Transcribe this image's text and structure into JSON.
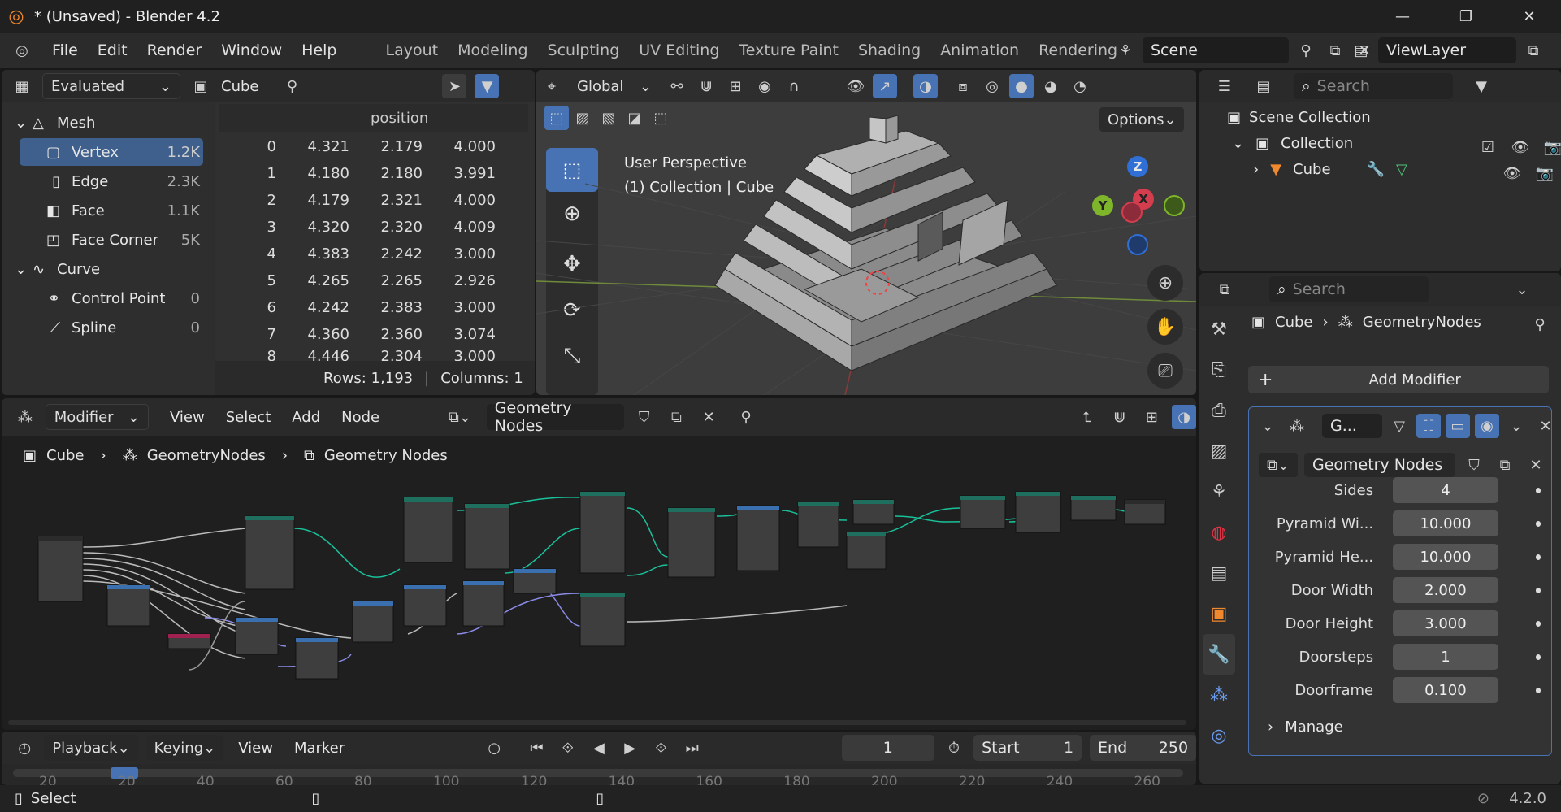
{
  "window": {
    "title": "* (Unsaved) - Blender 4.2"
  },
  "menu": [
    "File",
    "Edit",
    "Render",
    "Window",
    "Help"
  ],
  "workspaces": [
    "Layout",
    "Modeling",
    "Sculpting",
    "UV Editing",
    "Texture Paint",
    "Shading",
    "Animation",
    "Rendering"
  ],
  "scene": {
    "name": "Scene",
    "view_layer": "ViewLayer"
  },
  "spreadsheet": {
    "mode": "Evaluated",
    "object": "Cube",
    "column_header": "position",
    "tree": [
      {
        "label": "Mesh",
        "count": ""
      },
      {
        "label": "Vertex",
        "count": "1.2K"
      },
      {
        "label": "Edge",
        "count": "2.3K"
      },
      {
        "label": "Face",
        "count": "1.1K"
      },
      {
        "label": "Face Corner",
        "count": "5K"
      },
      {
        "label": "Curve",
        "count": ""
      },
      {
        "label": "Control Point",
        "count": "0"
      },
      {
        "label": "Spline",
        "count": "0"
      }
    ],
    "rows": [
      {
        "i": "0",
        "x": "4.321",
        "y": "2.179",
        "z": "4.000"
      },
      {
        "i": "1",
        "x": "4.180",
        "y": "2.180",
        "z": "3.991"
      },
      {
        "i": "2",
        "x": "4.179",
        "y": "2.321",
        "z": "4.000"
      },
      {
        "i": "3",
        "x": "4.320",
        "y": "2.320",
        "z": "4.009"
      },
      {
        "i": "4",
        "x": "4.383",
        "y": "2.242",
        "z": "3.000"
      },
      {
        "i": "5",
        "x": "4.265",
        "y": "2.265",
        "z": "2.926"
      },
      {
        "i": "6",
        "x": "4.242",
        "y": "2.383",
        "z": "3.000"
      },
      {
        "i": "7",
        "x": "4.360",
        "y": "2.360",
        "z": "3.074"
      },
      {
        "i": "8",
        "x": "4.446",
        "y": "2.304",
        "z": "3.000"
      }
    ],
    "footer_rows": "Rows: 1,193",
    "footer_cols": "Columns: 1"
  },
  "viewport": {
    "orientation": "Global",
    "options": "Options",
    "perspective": "User Perspective",
    "collection_info": "(1) Collection | Cube",
    "axes": {
      "z": "Z",
      "y": "Y",
      "x": "X"
    }
  },
  "outliner": {
    "search_placeholder": "Search",
    "items": [
      "Scene Collection",
      "Collection",
      "Cube"
    ]
  },
  "node_editor": {
    "mode": "Modifier",
    "menus": [
      "View",
      "Select",
      "Add",
      "Node"
    ],
    "tree_name": "Geometry Nodes",
    "breadcrumb": [
      "Cube",
      "GeometryNodes",
      "Geometry Nodes"
    ]
  },
  "properties": {
    "search_placeholder": "Search",
    "breadcrumb_object": "Cube",
    "breadcrumb_modifier": "GeometryNodes",
    "add_modifier": "Add Modifier",
    "modifier_name": "G...",
    "node_group": "Geometry Nodes",
    "inputs": [
      {
        "label": "Sides",
        "value": "4"
      },
      {
        "label": "Pyramid Wi...",
        "value": "10.000"
      },
      {
        "label": "Pyramid He...",
        "value": "10.000"
      },
      {
        "label": "Door Width",
        "value": "2.000"
      },
      {
        "label": "Door Height",
        "value": "3.000"
      },
      {
        "label": "Doorsteps",
        "value": "1"
      },
      {
        "label": "Doorframe",
        "value": "0.100"
      }
    ],
    "manage": "Manage"
  },
  "timeline": {
    "menus": [
      "Playback",
      "Keying",
      "View",
      "Marker"
    ],
    "current_frame": "1",
    "start_label": "Start",
    "start": "1",
    "end_label": "End",
    "end": "250",
    "ticks": [
      "20",
      "20",
      "40",
      "60",
      "80",
      "100",
      "120",
      "140",
      "160",
      "180",
      "200",
      "220",
      "240",
      "260"
    ]
  },
  "statusbar": {
    "left": "Select",
    "version": "4.2.0"
  },
  "colors": {
    "accent": "#4772b3",
    "selected": "#3f5f8c",
    "header": "#2a2a2a",
    "panel": "#303030"
  }
}
